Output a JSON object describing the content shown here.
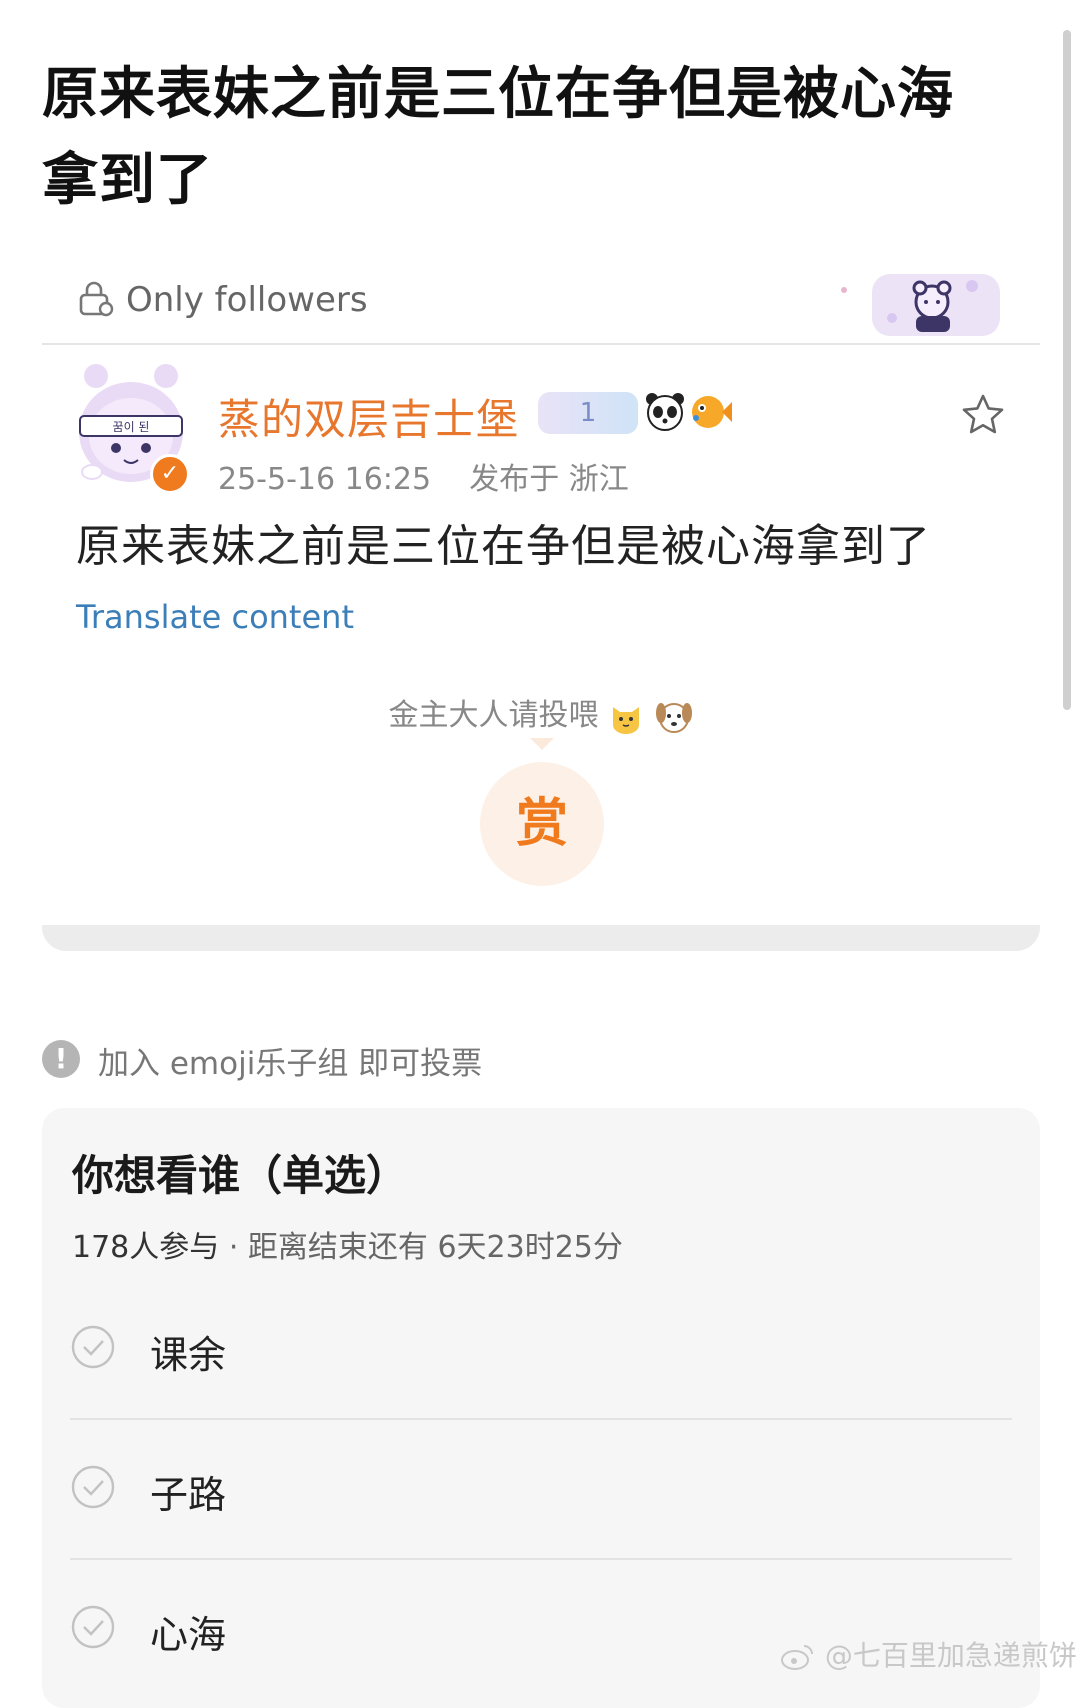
{
  "post_title": "原来表妹之前是三位在争但是被心海拿到了",
  "visibility": {
    "label": "Only followers"
  },
  "author": {
    "name": "蒸的双层吉士堡",
    "verified": true,
    "badge_text": "1",
    "avatar_caption": "꿈이 된"
  },
  "meta": {
    "time": "25-5-16 16:25",
    "location": "发布于 浙江"
  },
  "content": {
    "text": "原来表妹之前是三位在争但是被心海拿到了",
    "translate_label": "Translate content"
  },
  "reward": {
    "tip_text": "金主大人请投喂",
    "button_label": "赏"
  },
  "notice": {
    "text": "加入 emoji乐子组 即可投票"
  },
  "poll": {
    "title": "你想看谁（单选）",
    "participants": "178人参与",
    "separator": "·",
    "remaining": "距离结束还有 6天23时25分",
    "options": [
      {
        "label": "课余"
      },
      {
        "label": "子路"
      },
      {
        "label": "心海"
      }
    ]
  },
  "watermark": {
    "text": "@七百里加急递煎饼"
  },
  "colors": {
    "username": "#e8772e",
    "link": "#3c7fb8",
    "reward": "#f07a1e"
  }
}
